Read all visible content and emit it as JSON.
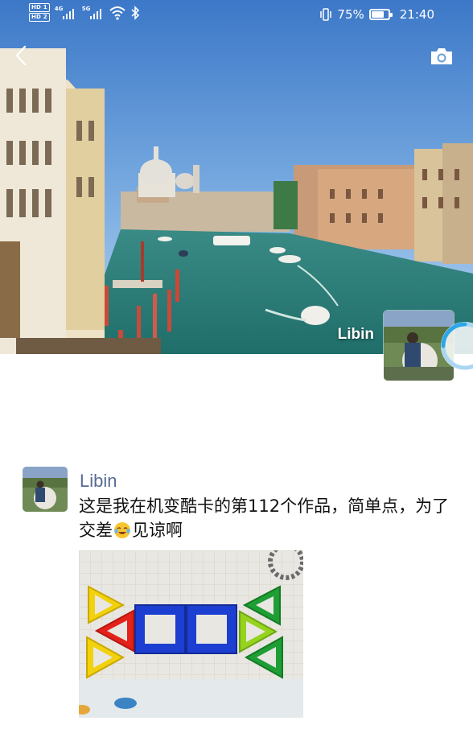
{
  "status_bar": {
    "sim1_tag": "HD 1",
    "sim2_tag": "HD 2",
    "sim1_network": "4G",
    "sim2_network": "5G",
    "battery_percent": "75%",
    "battery_level": 0.75,
    "time": "21:40",
    "icons": [
      "signal-icon",
      "wifi-icon",
      "bluetooth-icon",
      "vibrate-icon",
      "battery-icon"
    ]
  },
  "header": {
    "back_icon": "chevron-left-icon",
    "camera_icon": "camera-icon"
  },
  "profile": {
    "cover_name": "Libin"
  },
  "post": {
    "author": "Libin",
    "text_part1": "这是我在机变酷卡的第112个作品，简单点，为了交差",
    "emoji": "laughing-tears-emoji",
    "text_part2": "见谅啊"
  },
  "colors": {
    "author_link": "#576b95",
    "body_text": "#111111",
    "background": "#ffffff"
  }
}
